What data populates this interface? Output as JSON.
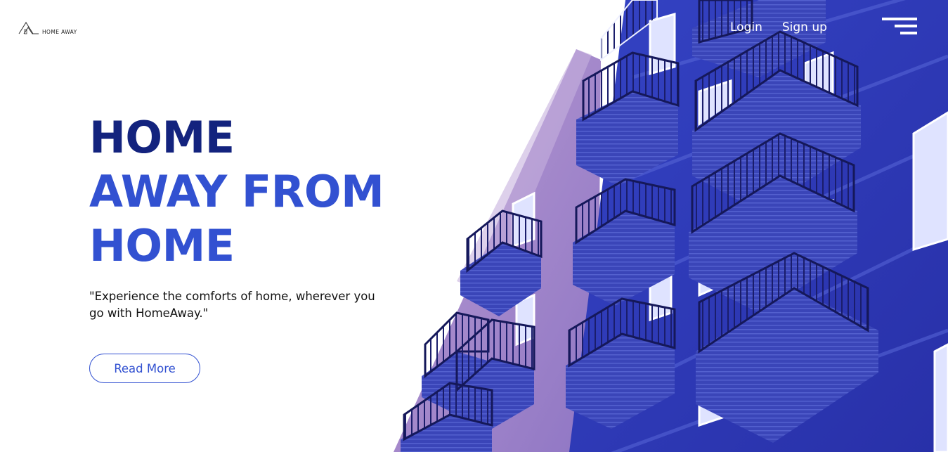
{
  "brand": {
    "logo_text": "HOME AWAY",
    "logo_icon": "house-icon"
  },
  "nav": {
    "login_label": "Login",
    "signup_label": "Sign up",
    "menu_icon": "hamburger-menu-icon"
  },
  "hero": {
    "headline_line1": "HOME",
    "headline_line2": "AWAY FROM",
    "headline_line3": "HOME",
    "tagline": "\"Experience the comforts of home, wherever you go with HomeAway.\"",
    "cta_label": "Read More",
    "image": "apartment-building-balconies"
  },
  "colors": {
    "headline_dark": "#13237e",
    "headline_accent": "#3251d1",
    "building_blue": "#2d35b0",
    "building_lavender": "#a488c9",
    "white": "#ffffff"
  }
}
